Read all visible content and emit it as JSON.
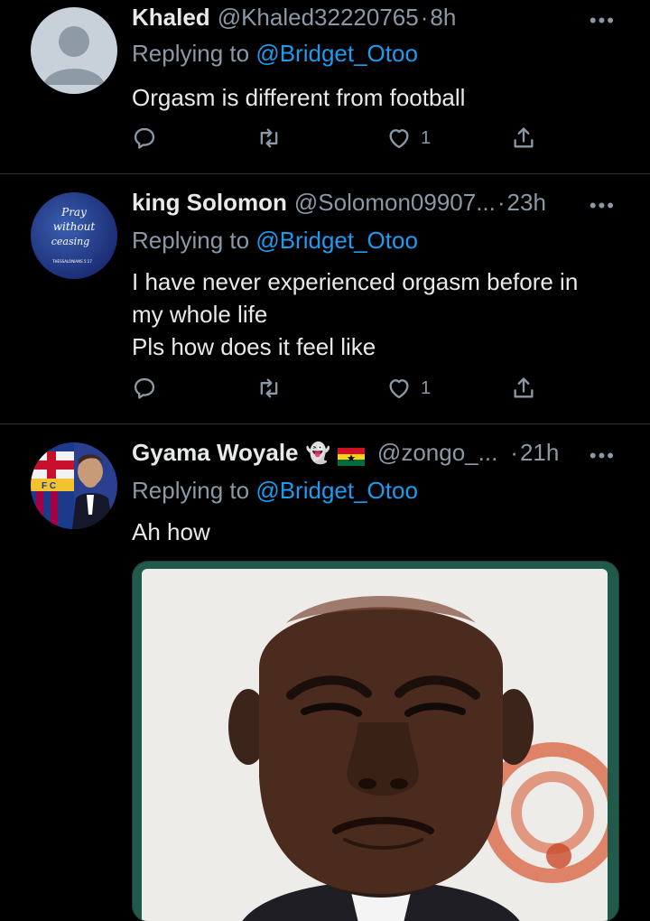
{
  "tweets": [
    {
      "name": "Khaled",
      "handle": "@Khaled32220765",
      "dot": "·",
      "time": "8h",
      "replying_prefix": "Replying to ",
      "replying_to": "@Bridget_Otoo",
      "lines": [
        "Orgasm is different from football"
      ],
      "like_count": "1",
      "more": "•••",
      "avatar_icon": "default-profile-icon"
    },
    {
      "name": "king Solomon",
      "handle": "@Solomon09907...",
      "dot": "·",
      "time": "23h",
      "replying_prefix": "Replying to ",
      "replying_to": "@Bridget_Otoo",
      "lines": [
        "I have never experienced orgasm before in",
        "my whole life",
        "Pls how does it feel like"
      ],
      "like_count": "1",
      "more": "•••",
      "avatar_text": [
        "Pray",
        "without",
        "ceasing",
        "THESSALONIANS 5:17"
      ]
    },
    {
      "name": "Gyama Woyale",
      "emoji": "👻",
      "handle": "@zongo_...",
      "dot": "·",
      "time": "21h",
      "replying_prefix": "Replying to ",
      "replying_to": "@Bridget_Otoo",
      "lines": [
        "Ah how"
      ],
      "more": "•••",
      "avatar_text": [
        "F C"
      ]
    }
  ],
  "colors": {
    "background": "#000000",
    "text": "#e7e9ea",
    "secondary": "#8b98a5",
    "accent": "#1d9bf0",
    "divider": "#2f3336"
  },
  "icons": [
    "reply-icon",
    "retweet-icon",
    "like-icon",
    "share-icon",
    "more-icon",
    "ghost-emoji",
    "ghana-flag-icon"
  ]
}
